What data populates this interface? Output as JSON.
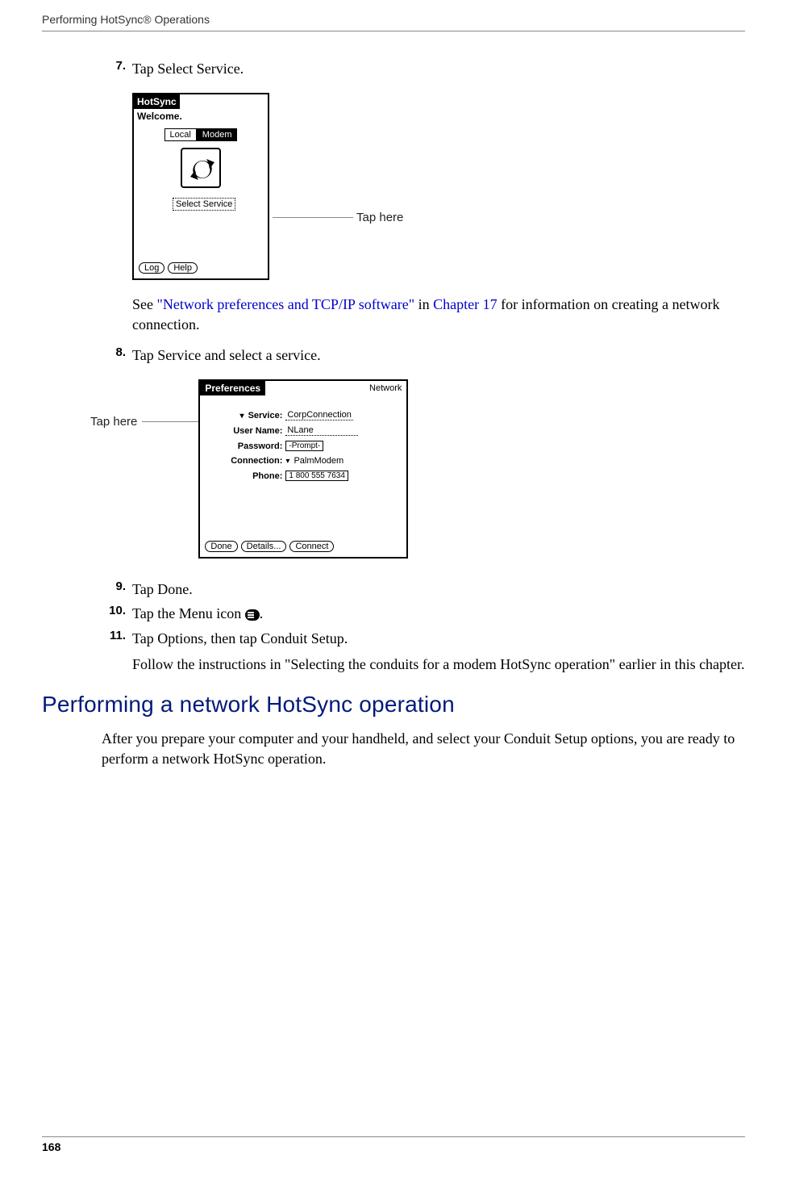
{
  "header": "Performing HotSync® Operations",
  "step7": {
    "num": "7.",
    "text": "Tap Select Service."
  },
  "shot1": {
    "title": "HotSync",
    "welcome": "Welcome.",
    "tab_local": "Local",
    "tab_modem": "Modem",
    "select_service": "Select Service",
    "log": "Log",
    "help": "Help",
    "callout": "Tap here"
  },
  "step7_after": {
    "see": "See ",
    "link1": "\"Network preferences and TCP/IP software\"",
    "mid": " in ",
    "link2": "Chapter 17",
    "rest": " for information on creating a network connection."
  },
  "step8": {
    "num": "8.",
    "text": "Tap Service and select a service."
  },
  "shot2": {
    "callout": "Tap here",
    "title": "Preferences",
    "category": "Network",
    "service_lbl": "Service:",
    "service_val": "CorpConnection",
    "user_lbl": "User Name:",
    "user_val": "NLane",
    "pwd_lbl": "Password:",
    "pwd_val": "-Prompt-",
    "conn_lbl": "Connection:",
    "conn_val": "PalmModem",
    "phone_lbl": "Phone:",
    "phone_val": "1 800 555 7634",
    "done": "Done",
    "details": "Details...",
    "connect": "Connect"
  },
  "step9": {
    "num": "9.",
    "text": "Tap Done."
  },
  "step10": {
    "num": "10.",
    "text_a": "Tap the Menu icon ",
    "text_b": "."
  },
  "step11": {
    "num": "11.",
    "text": "Tap Options, then tap Conduit Setup."
  },
  "step11_after": "Follow the instructions in \"Selecting the conduits for a modem HotSync operation\" earlier in this chapter.",
  "section_heading": "Performing a network HotSync operation",
  "section_para": "After you prepare your computer and your handheld, and select your Conduit Setup options, you are ready to perform a network HotSync operation.",
  "page_num": "168"
}
